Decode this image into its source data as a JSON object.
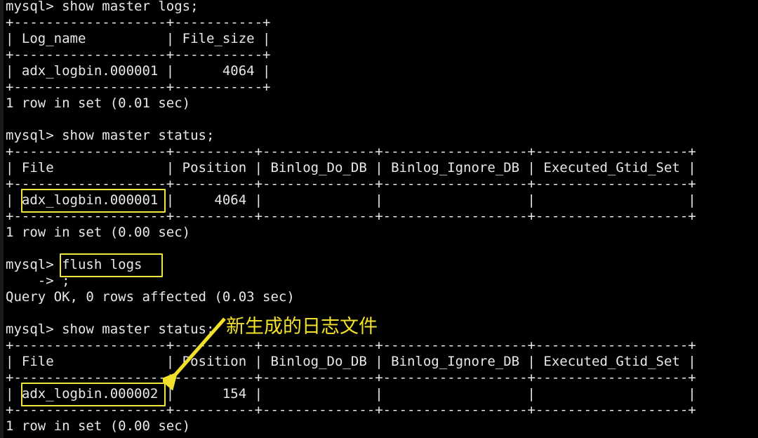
{
  "terminal": {
    "background_color": "#000000",
    "text_color": "#e8e8e8",
    "highlight_color": "#f2e43c",
    "annotation_color": "#f2e02a",
    "prompt": "mysql>",
    "continuation_prompt": "->"
  },
  "lines": [
    {
      "id": "l01",
      "text": "mysql> show master logs;"
    },
    {
      "id": "l02",
      "text": "+-------------------+-----------+"
    },
    {
      "id": "l03",
      "text": "| Log_name          | File_size |"
    },
    {
      "id": "l04",
      "text": "+-------------------+-----------+"
    },
    {
      "id": "l05",
      "text": "| adx_logbin.000001 |      4064 |"
    },
    {
      "id": "l06",
      "text": "+-------------------+-----------+"
    },
    {
      "id": "l07",
      "text": "1 row in set (0.01 sec)"
    },
    {
      "id": "l08",
      "text": ""
    },
    {
      "id": "l09",
      "text": "mysql> show master status;"
    },
    {
      "id": "l10",
      "text": "+-------------------+----------+--------------+------------------+-------------------+"
    },
    {
      "id": "l11",
      "text": "| File              | Position | Binlog_Do_DB | Binlog_Ignore_DB | Executed_Gtid_Set |"
    },
    {
      "id": "l12",
      "text": "+-------------------+----------+--------------+------------------+-------------------+"
    },
    {
      "id": "l13",
      "text": "| adx_logbin.000001 |     4064 |              |                  |                   |"
    },
    {
      "id": "l14",
      "text": "+-------------------+----------+--------------+------------------+-------------------+"
    },
    {
      "id": "l15",
      "text": "1 row in set (0.00 sec)"
    },
    {
      "id": "l16",
      "text": ""
    },
    {
      "id": "l17",
      "text": "mysql> flush logs"
    },
    {
      "id": "l18",
      "text": "    -> ;"
    },
    {
      "id": "l19",
      "text": "Query OK, 0 rows affected (0.03 sec)"
    },
    {
      "id": "l20",
      "text": ""
    },
    {
      "id": "l21",
      "text": "mysql> show master status;"
    },
    {
      "id": "l22",
      "text": "+-------------------+----------+--------------+------------------+-------------------+"
    },
    {
      "id": "l23",
      "text": "| File              | Position | Binlog_Do_DB | Binlog_Ignore_DB | Executed_Gtid_Set |"
    },
    {
      "id": "l24",
      "text": "+-------------------+----------+--------------+------------------+-------------------+"
    },
    {
      "id": "l25",
      "text": "| adx_logbin.000002 |      154 |              |                  |                   |"
    },
    {
      "id": "l26",
      "text": "+-------------------+----------+--------------+------------------+-------------------+"
    },
    {
      "id": "l27",
      "text": "1 row in set (0.00 sec)"
    }
  ],
  "commands": [
    {
      "name": "show-master-logs",
      "text": "show master logs;"
    },
    {
      "name": "show-master-status-1",
      "text": "show master status;"
    },
    {
      "name": "flush-logs",
      "text": "flush logs"
    },
    {
      "name": "show-master-status-2",
      "text": "show master status;"
    }
  ],
  "tables": {
    "master_logs": {
      "headers": [
        "Log_name",
        "File_size"
      ],
      "rows": [
        [
          "adx_logbin.000001",
          "4064"
        ]
      ],
      "result_line": "1 row in set (0.01 sec)"
    },
    "master_status_before": {
      "headers": [
        "File",
        "Position",
        "Binlog_Do_DB",
        "Binlog_Ignore_DB",
        "Executed_Gtid_Set"
      ],
      "rows": [
        [
          "adx_logbin.000001",
          "4064",
          "",
          "",
          ""
        ]
      ],
      "result_line": "1 row in set (0.00 sec)"
    },
    "master_status_after": {
      "headers": [
        "File",
        "Position",
        "Binlog_Do_DB",
        "Binlog_Ignore_DB",
        "Executed_Gtid_Set"
      ],
      "rows": [
        [
          "adx_logbin.000002",
          "154",
          "",
          "",
          ""
        ]
      ],
      "result_line": "1 row in set (0.00 sec)"
    }
  },
  "flush_result": "Query OK, 0 rows affected (0.03 sec)",
  "annotation": {
    "text": "新生成的日志文件",
    "color": "#f2e02a"
  },
  "highlights": [
    {
      "name": "highlight-file-000001",
      "value": "adx_logbin.000001"
    },
    {
      "name": "highlight-flush-logs",
      "value": "flush logs"
    },
    {
      "name": "highlight-file-000002",
      "value": "adx_logbin.000002"
    }
  ]
}
